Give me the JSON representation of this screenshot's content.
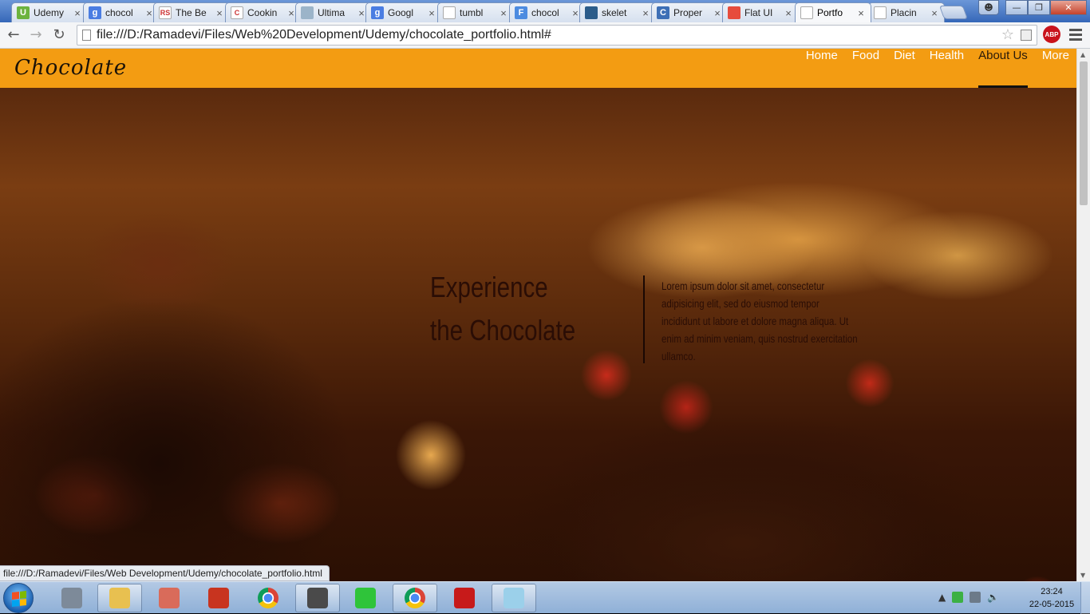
{
  "browser": {
    "tabs": [
      {
        "title": "Udemy",
        "icon": "udemy-icon",
        "color": "#6cb33e",
        "glyph": "U"
      },
      {
        "title": "chocol",
        "icon": "google-icon",
        "color": "#4a7de2",
        "glyph": "g"
      },
      {
        "title": "The Be",
        "icon": "rs-icon",
        "color": "#ffffff",
        "glyph": "RS"
      },
      {
        "title": "Cookin",
        "icon": "cooking-icon",
        "color": "#ffffff",
        "glyph": "C"
      },
      {
        "title": "Ultima",
        "icon": "globe-icon",
        "color": "#9bb4c9",
        "glyph": ""
      },
      {
        "title": "Googl",
        "icon": "google-icon",
        "color": "#4a7de2",
        "glyph": "g"
      },
      {
        "title": "tumbl",
        "icon": "page-icon",
        "color": "#ffffff",
        "glyph": ""
      },
      {
        "title": "chocol",
        "icon": "f-icon",
        "color": "#4c8be0",
        "glyph": "F"
      },
      {
        "title": "skelet",
        "icon": "grid-icon",
        "color": "#2b5c8a",
        "glyph": ""
      },
      {
        "title": "Proper",
        "icon": "css-icon",
        "color": "#3d6fb6",
        "glyph": "C"
      },
      {
        "title": "Flat UI",
        "icon": "flatui-icon",
        "color": "#e74c3c",
        "glyph": ""
      },
      {
        "title": "Portfo",
        "icon": "page-icon",
        "color": "#ffffff",
        "glyph": "",
        "active": true
      },
      {
        "title": "Placin",
        "icon": "linux-icon",
        "color": "#ffffff",
        "glyph": ""
      }
    ],
    "url": "file:///D:/Ramadevi/Files/Web%20Development/Udemy/chocolate_portfolio.html#",
    "abp_label": "ABP",
    "status_url": "file:///D:/Ramadevi/Files/Web Development/Udemy/chocolate_portfolio.html"
  },
  "site": {
    "logo": "Chocolate",
    "nav": [
      {
        "label": "Home",
        "active": false
      },
      {
        "label": "Food",
        "active": false
      },
      {
        "label": "Diet",
        "active": false
      },
      {
        "label": "Health",
        "active": false
      },
      {
        "label": "About Us",
        "active": true
      },
      {
        "label": "More",
        "active": false
      }
    ],
    "hero": {
      "title": "Experience the Chocolate",
      "text": "Lorem ipsum dolor sit amet, consectetur adipisicing elit, sed do eiusmod tempor incididunt ut labore et dolore magna aliqua. Ut enim ad minim veniam, quis nostrud exercitation ullamco."
    },
    "colors": {
      "nav_bg": "#f39c12",
      "hero_text": "#2a0d05"
    }
  },
  "taskbar": {
    "apps": [
      {
        "name": "explorer-utility-icon",
        "color": "#7d8a99",
        "pinned": false
      },
      {
        "name": "file-explorer-icon",
        "color": "#e8c050",
        "pinned": true
      },
      {
        "name": "vector-app-icon",
        "color": "#d96b5a",
        "pinned": false
      },
      {
        "name": "ccleaner-icon",
        "color": "#c8341f",
        "pinned": false
      },
      {
        "name": "chrome-icon",
        "color": "#e0a81a",
        "pinned": false
      },
      {
        "name": "sublime-text-icon",
        "color": "#4a4a4a",
        "pinned": true
      },
      {
        "name": "emu8086-icon",
        "color": "#2fc43a",
        "pinned": false
      },
      {
        "name": "chrome-icon",
        "color": "#e0a81a",
        "pinned": true
      },
      {
        "name": "acrobat-icon",
        "color": "#c71a1a",
        "pinned": false
      },
      {
        "name": "notepad-icon",
        "color": "#9bd0ea",
        "pinned": true
      }
    ],
    "time": "23:24",
    "date": "22-05-2015"
  }
}
